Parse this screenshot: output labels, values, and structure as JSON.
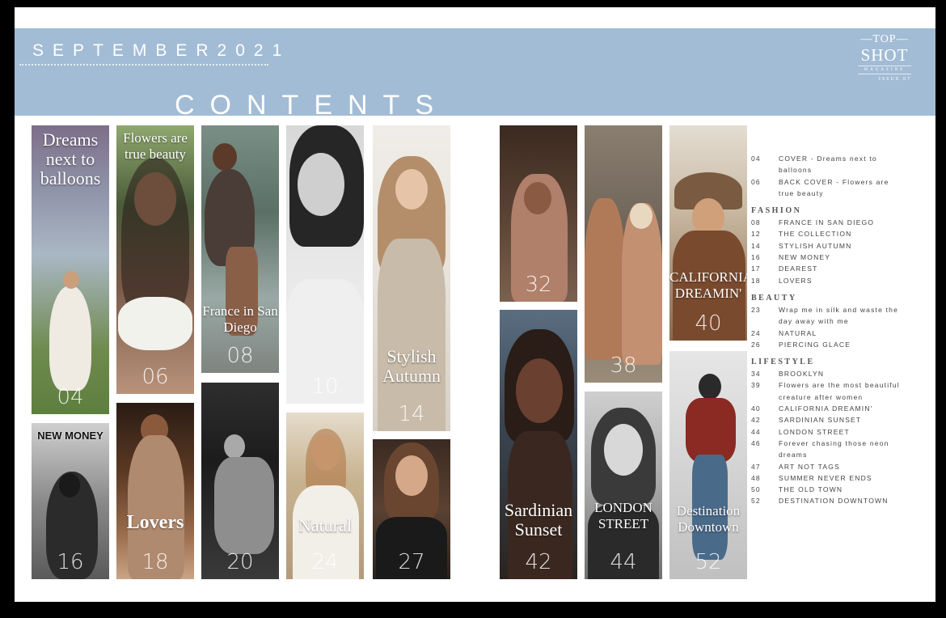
{
  "header": {
    "date": "SEPTEMBER2021",
    "title": "CONTENTS",
    "logo": {
      "top": "—TOP—",
      "main": "SHOT",
      "sub": "MAGAZINE",
      "issue": "ISSUE 07"
    }
  },
  "photos": {
    "p04": {
      "caption": "Dreams next to balloons",
      "number": "04"
    },
    "p06": {
      "caption": "Flowers are true beauty",
      "number": "06"
    },
    "p08": {
      "caption": "France in San Diego",
      "number": "08"
    },
    "p10": {
      "number": "10"
    },
    "p14": {
      "caption": "Stylish Autumn",
      "number": "14"
    },
    "p16": {
      "caption": "NEW MONEY",
      "number": "16"
    },
    "p18": {
      "caption": "Lovers",
      "number": "18"
    },
    "p20": {
      "number": "20"
    },
    "p24": {
      "caption": "Natural",
      "number": "24"
    },
    "p27": {
      "number": "27"
    },
    "p32": {
      "number": "32"
    },
    "p38": {
      "number": "38"
    },
    "p40": {
      "caption": "CALIFORNIA DREAMIN'",
      "number": "40"
    },
    "p42": {
      "caption": "Sardinian Sunset",
      "number": "42"
    },
    "p44": {
      "caption": "LONDON STREET",
      "number": "44"
    },
    "p52": {
      "caption": "Destination Downtown",
      "number": "52"
    }
  },
  "toc": {
    "intro": [
      {
        "page": "04",
        "title": "COVER - Dreams next to balloons"
      },
      {
        "page": "06",
        "title": "BACK COVER - Flowers are true beauty"
      }
    ],
    "fashion": {
      "heading": "FASHION",
      "items": [
        {
          "page": "08",
          "title": "FRANCE IN SAN DIEGO"
        },
        {
          "page": "12",
          "title": "THE COLLECTION"
        },
        {
          "page": "14",
          "title": "STYLISH AUTUMN"
        },
        {
          "page": "16",
          "title": "NEW MONEY"
        },
        {
          "page": "17",
          "title": "DEAREST"
        },
        {
          "page": "18",
          "title": "LOVERS"
        }
      ]
    },
    "beauty": {
      "heading": "BEAUTY",
      "items": [
        {
          "page": "23",
          "title": "Wrap me in silk and waste the day away with me"
        },
        {
          "page": "24",
          "title": "NATURAL"
        },
        {
          "page": "26",
          "title": "PIERCING GLACE"
        }
      ]
    },
    "lifestyle": {
      "heading": "LIFESTYLE",
      "items": [
        {
          "page": "34",
          "title": "BROOKLYN"
        },
        {
          "page": "39",
          "title": "Flowers are the most beautiful creature after women"
        },
        {
          "page": "40",
          "title": "CALIFORNIA DREAMIN'"
        },
        {
          "page": "42",
          "title": "SARDINIAN SUNSET"
        },
        {
          "page": "44",
          "title": "LONDON STREET"
        },
        {
          "page": "46",
          "title": "Forever chasing those neon dreams"
        },
        {
          "page": "47",
          "title": "ART NOT TAGS"
        },
        {
          "page": "48",
          "title": "SUMMER NEVER ENDS"
        },
        {
          "page": "50",
          "title": "THE OLD TOWN"
        },
        {
          "page": "52",
          "title": "DESTINATION DOWNTOWN"
        }
      ]
    }
  },
  "colors": {
    "band": "#a2bcd5",
    "background": "#000000",
    "page": "#ffffff"
  }
}
